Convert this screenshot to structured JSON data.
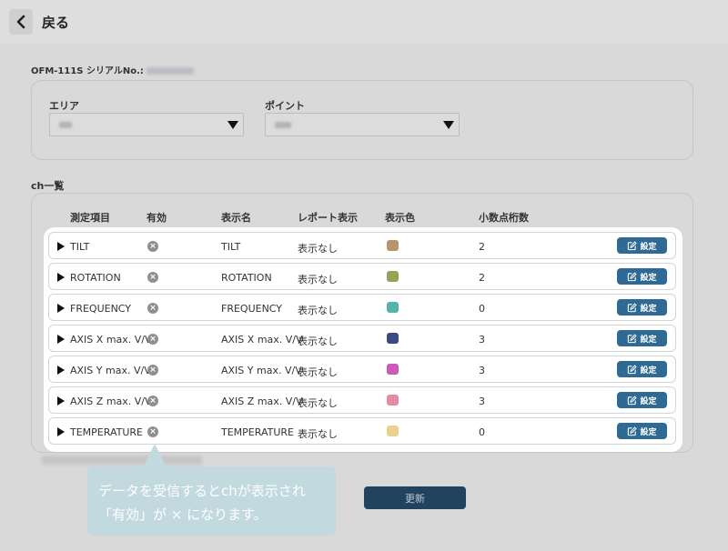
{
  "header": {
    "back_label": "戻る"
  },
  "serial": {
    "label": "OFM-111S シリアルNo.:"
  },
  "selectors": {
    "area_label": "エリア",
    "point_label": "ポイント"
  },
  "ch_list": {
    "title": "ch一覧",
    "columns": [
      "測定項目",
      "有効",
      "表示名",
      "レポート表示",
      "表示色",
      "小数点桁数"
    ],
    "rows": [
      {
        "item": "TILT",
        "enabled_icon": "×",
        "display_name": "TILT",
        "report": "表示なし",
        "color": "#b8936b",
        "decimals": "2",
        "button": "設定"
      },
      {
        "item": "ROTATION",
        "enabled_icon": "×",
        "display_name": "ROTATION",
        "report": "表示なし",
        "color": "#9aa055",
        "decimals": "2",
        "button": "設定"
      },
      {
        "item": "FREQUENCY",
        "enabled_icon": "×",
        "display_name": "FREQUENCY",
        "report": "表示なし",
        "color": "#55b3ad",
        "decimals": "0",
        "button": "設定"
      },
      {
        "item": "AXIS X max. V/V",
        "enabled_icon": "×",
        "display_name": "AXIS X max. V/V",
        "report": "表示なし",
        "color": "#3b4a82",
        "decimals": "3",
        "button": "設定"
      },
      {
        "item": "AXIS Y max. V/V",
        "enabled_icon": "×",
        "display_name": "AXIS Y max. V/V",
        "report": "表示なし",
        "color": "#cc5ab9",
        "decimals": "3",
        "button": "設定"
      },
      {
        "item": "AXIS Z max. V/V",
        "enabled_icon": "×",
        "display_name": "AXIS Z max. V/V",
        "report": "表示なし",
        "color": "#e48aa2",
        "decimals": "3",
        "button": "設定"
      },
      {
        "item": "TEMPERATURE",
        "enabled_icon": "×",
        "display_name": "TEMPERATURE",
        "report": "表示なし",
        "color": "#ecd08f",
        "decimals": "0",
        "button": "設定"
      }
    ]
  },
  "actions": {
    "update_label": "更新"
  },
  "tooltip": {
    "line1": "データを受信するとchが表示され",
    "line2": "「有効」が × になります。"
  },
  "icons": {
    "back": "chevron-left-icon",
    "disabled": "x-circle-icon",
    "edit": "edit-icon",
    "expand": "triangle-right-icon"
  }
}
